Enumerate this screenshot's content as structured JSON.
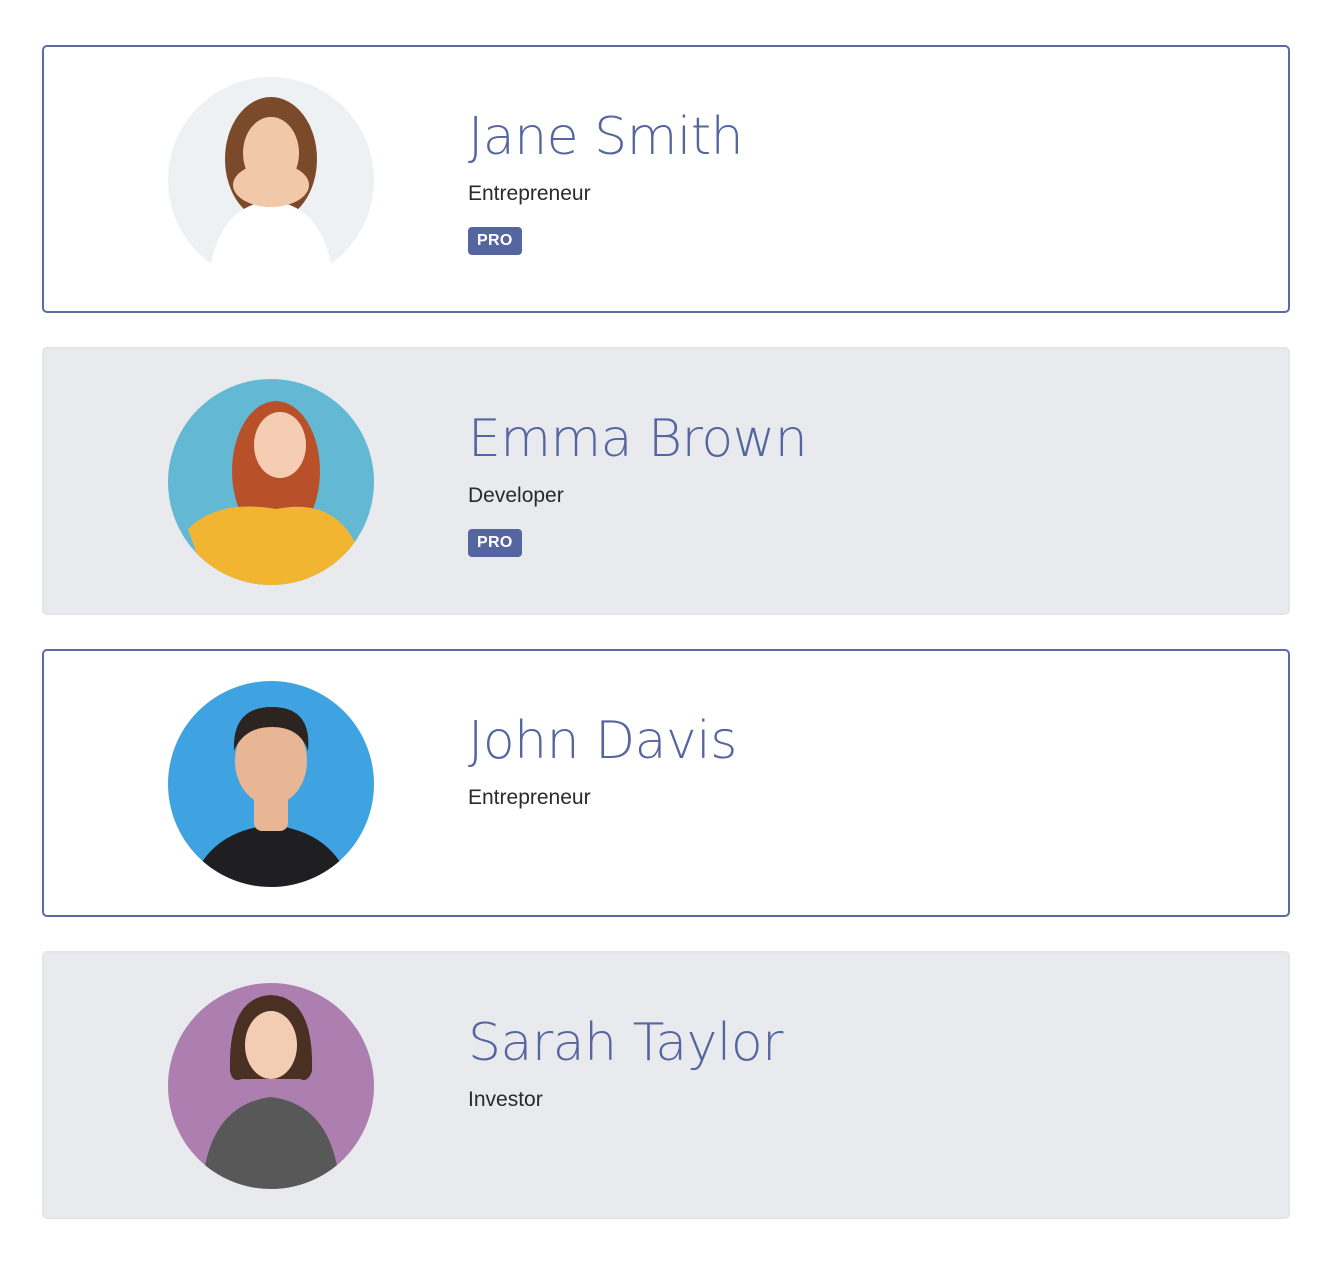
{
  "profiles": [
    {
      "name": "Jane Smith",
      "role": "Entrepreneur",
      "badge": "PRO",
      "style": "outlined",
      "photo_bg": "#eef1f4",
      "hair": "#7a4a2a",
      "shirt": "#ffffff",
      "skin": "#f2c9a8"
    },
    {
      "name": "Emma Brown",
      "role": "Developer",
      "badge": "PRO",
      "style": "filled",
      "photo_bg": "#63b9d4",
      "hair": "#b8502a",
      "shirt": "#f2b531",
      "skin": "#f4cdb3"
    },
    {
      "name": "John Davis",
      "role": "Entrepreneur",
      "badge": "",
      "style": "outlined",
      "photo_bg": "#3fa3e2",
      "hair": "#2b2420",
      "shirt": "#1f1f21",
      "skin": "#e8b694"
    },
    {
      "name": "Sarah Taylor",
      "role": "Investor",
      "badge": "",
      "style": "filled",
      "photo_bg": "#ad7fb0",
      "hair": "#4a3022",
      "shirt": "#585858",
      "skin": "#f2cdb4"
    }
  ]
}
